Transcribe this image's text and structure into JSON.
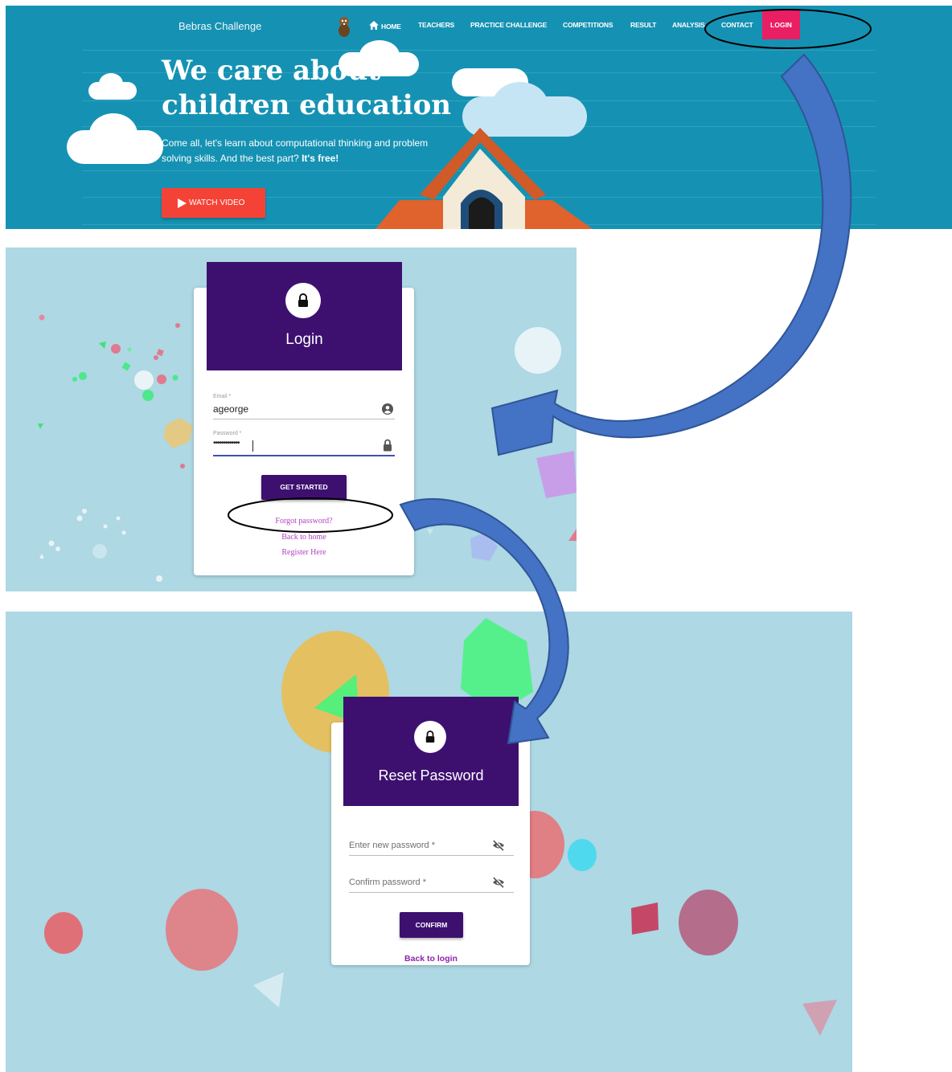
{
  "home": {
    "brand": "Bebras Challenge",
    "nav": {
      "home": "HOME",
      "teachers": "TEACHERS",
      "practice": "PRACTICE CHALLENGE",
      "competitions": "COMPETITIONS",
      "result": "RESULT",
      "analysis": "ANALYSIS",
      "contact": "CONTACT",
      "login": "LOGIN"
    },
    "hero": {
      "title_line1": "We care about",
      "title_line2": "children education",
      "subtitle_line1": "Come all, let's learn about computational thinking and problem",
      "subtitle_line2_prefix": "solving skills. And the best part? ",
      "subtitle_line2_bold": "It's free!",
      "watch_button": "WATCH VIDEO"
    },
    "colors": {
      "background": "#1592b3",
      "login_accent": "#e91e63",
      "watch_button": "#f44336"
    }
  },
  "login": {
    "title": "Login",
    "icon": "lock-icon",
    "email_label": "Email *",
    "email_value": "ageorge",
    "email_icon": "account-circle-icon",
    "password_label": "Password *",
    "password_value": "•••••••••••••",
    "password_icon": "lock-icon",
    "submit_button": "GET STARTED",
    "forgot_link": "Forgot password?",
    "home_link": "Back to home",
    "register_link": "Register Here",
    "colors": {
      "header": "#3d1070",
      "link": "#b142c4",
      "background": "#add8e4"
    }
  },
  "reset": {
    "title": "Reset Password",
    "icon": "lock-icon",
    "new_password_placeholder": "Enter new password *",
    "confirm_password_placeholder": "Confirm password *",
    "visibility_icon": "eye-off-icon",
    "confirm_button": "CONFIRM",
    "back_link": "Back to login",
    "colors": {
      "header": "#3d1070",
      "link": "#8e24aa"
    }
  },
  "annotations": {
    "arrow_color": "#4472c4",
    "highlight_1_target": "LOGIN",
    "highlight_2_target": "Forgot password?"
  }
}
